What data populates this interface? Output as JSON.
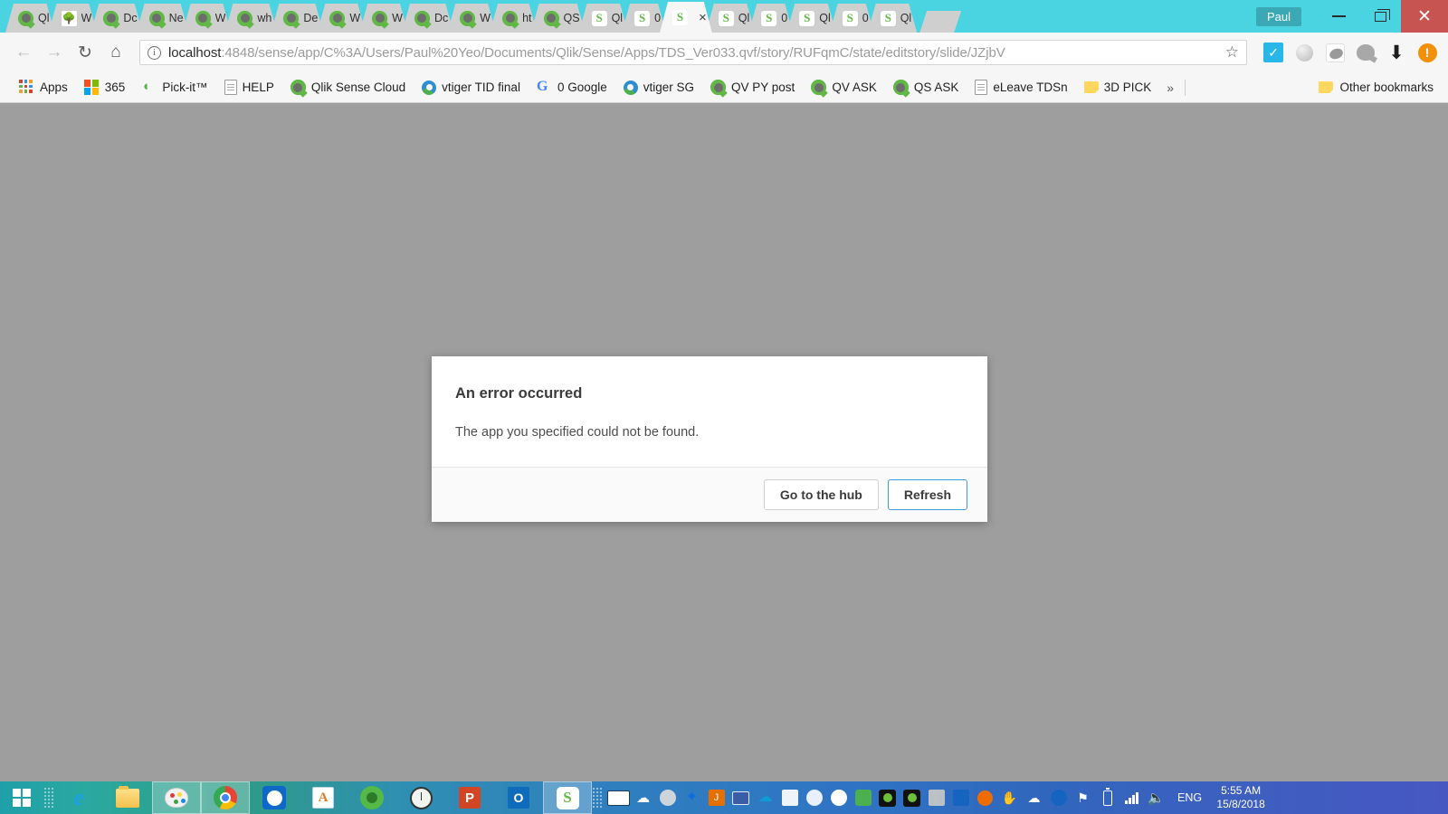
{
  "window": {
    "user_chip": "Paul",
    "minimize_label": "Minimize",
    "restore_label": "Restore",
    "close_label": "Close"
  },
  "tabs": [
    {
      "title": "Ql",
      "favicon": "qlikview-icon",
      "active": false
    },
    {
      "title": "W",
      "favicon": "tree-icon",
      "active": false
    },
    {
      "title": "Dc",
      "favicon": "qlikview-icon",
      "active": false
    },
    {
      "title": "Ne",
      "favicon": "qlikview-icon",
      "active": false
    },
    {
      "title": "W",
      "favicon": "qlikview-icon",
      "active": false
    },
    {
      "title": "wh",
      "favicon": "qlikview-icon",
      "active": false
    },
    {
      "title": "De",
      "favicon": "qlikview-icon",
      "active": false
    },
    {
      "title": "W",
      "favicon": "qlikview-icon",
      "active": false
    },
    {
      "title": "W",
      "favicon": "qlikview-icon",
      "active": false
    },
    {
      "title": "Dc",
      "favicon": "qlikview-icon",
      "active": false
    },
    {
      "title": "W",
      "favicon": "qlikview-icon",
      "active": false
    },
    {
      "title": "ht",
      "favicon": "qlikview-icon",
      "active": false
    },
    {
      "title": "QS",
      "favicon": "qlikview-icon",
      "active": false
    },
    {
      "title": "Ql",
      "favicon": "qliksense-icon",
      "active": false
    },
    {
      "title": "0 ",
      "favicon": "qliksense-icon",
      "active": false
    },
    {
      "title": "",
      "favicon": "qliksense-icon",
      "active": true,
      "close": "×"
    },
    {
      "title": "Ql",
      "favicon": "qliksense-icon",
      "active": false
    },
    {
      "title": "0 ",
      "favicon": "qliksense-icon",
      "active": false
    },
    {
      "title": "Ql",
      "favicon": "qliksense-icon",
      "active": false
    },
    {
      "title": "0 ",
      "favicon": "qliksense-icon",
      "active": false
    },
    {
      "title": "Ql",
      "favicon": "qliksense-icon",
      "active": false
    }
  ],
  "toolbar": {
    "back_label": "←",
    "forward_label": "→",
    "reload_label": "↻",
    "home_label": "⌂",
    "star_label": "☆",
    "site_info_label": "i",
    "url_host": "localhost",
    "url_path": ":4848/sense/app/C%3A/Users/Paul%20Yeo/Documents/Qlik/Sense/Apps/TDS_Ver033.qvf/story/RUFqmC/state/editstory/slide/JZjbV",
    "url_full": "localhost:4848/sense/app/C%3A/Users/Paul%20Yeo/Documents/Qlik/Sense/Apps/TDS_Ver033.qvf/story/RUFqmC/state/editstory/slide/JZjbV",
    "extensions": [
      {
        "name": "checkmark-extension-icon"
      },
      {
        "name": "circle-extension-icon"
      },
      {
        "name": "badge-extension-icon"
      },
      {
        "name": "globe-extension-icon"
      },
      {
        "name": "download-extension-icon"
      },
      {
        "name": "alert-extension-icon"
      }
    ]
  },
  "bookmarks": {
    "items": [
      {
        "label": "Apps",
        "icon": "apps-grid-icon"
      },
      {
        "label": "365",
        "icon": "microsoft-icon"
      },
      {
        "label": "Pick-it™",
        "icon": "pickit-icon"
      },
      {
        "label": "HELP",
        "icon": "document-icon"
      },
      {
        "label": "Qlik Sense Cloud",
        "icon": "qlikview-icon"
      },
      {
        "label": "vtiger TID final",
        "icon": "vtiger-icon"
      },
      {
        "label": "0 Google",
        "icon": "google-icon"
      },
      {
        "label": "vtiger SG",
        "icon": "vtiger-icon"
      },
      {
        "label": "QV PY post",
        "icon": "qlikview-icon"
      },
      {
        "label": "QV ASK",
        "icon": "qlikview-icon"
      },
      {
        "label": "QS ASK",
        "icon": "qlikview-icon"
      },
      {
        "label": "eLeave TDSn",
        "icon": "document-icon"
      },
      {
        "label": "3D PICK",
        "icon": "folder-icon"
      }
    ],
    "overflow_label": "»",
    "other_label": "Other bookmarks",
    "other_icon": "folder-icon"
  },
  "dialog": {
    "title": "An error occurred",
    "message": "The app you specified could not be found.",
    "buttons": [
      {
        "label": "Go to the hub",
        "primary": false
      },
      {
        "label": "Refresh",
        "primary": true
      }
    ],
    "accent_color": "#3b9bd4"
  },
  "taskbar": {
    "start_label": "Start",
    "items": [
      {
        "name": "internet-explorer-icon",
        "active": false
      },
      {
        "name": "file-explorer-icon",
        "active": false
      },
      {
        "name": "paint-icon",
        "active": true
      },
      {
        "name": "chrome-icon",
        "active": true
      },
      {
        "name": "teamviewer-icon",
        "active": false
      },
      {
        "name": "wordpad-icon",
        "active": false
      },
      {
        "name": "qlikview-icon",
        "active": false
      },
      {
        "name": "clock-notebook-icon",
        "active": false
      },
      {
        "name": "powerpoint-icon",
        "active": false
      },
      {
        "name": "outlook-icon",
        "active": false
      },
      {
        "name": "qliksense-icon",
        "active": true
      }
    ],
    "tray": [
      {
        "name": "keyboard-icon"
      },
      {
        "name": "cloud-upload-icon"
      },
      {
        "name": "clock-icon"
      },
      {
        "name": "dropbox-icon"
      },
      {
        "name": "java-icon"
      },
      {
        "name": "monitor-icon"
      },
      {
        "name": "onedrive-icon"
      },
      {
        "name": "disk-icon"
      },
      {
        "name": "sync-icon"
      },
      {
        "name": "cloud-icon"
      },
      {
        "name": "earth-icon"
      },
      {
        "name": "camera-icon"
      },
      {
        "name": "camera2-icon"
      },
      {
        "name": "display-icon"
      },
      {
        "name": "mouse-icon"
      },
      {
        "name": "orange-circle-icon"
      },
      {
        "name": "hand-icon"
      },
      {
        "name": "weather-warning-icon"
      },
      {
        "name": "teamviewer-tray-icon"
      },
      {
        "name": "network-flag-icon"
      },
      {
        "name": "battery-icon"
      },
      {
        "name": "signal-icon"
      },
      {
        "name": "volume-icon"
      }
    ],
    "language": "ENG",
    "time": "5:55 AM",
    "date": "15/8/2018"
  }
}
